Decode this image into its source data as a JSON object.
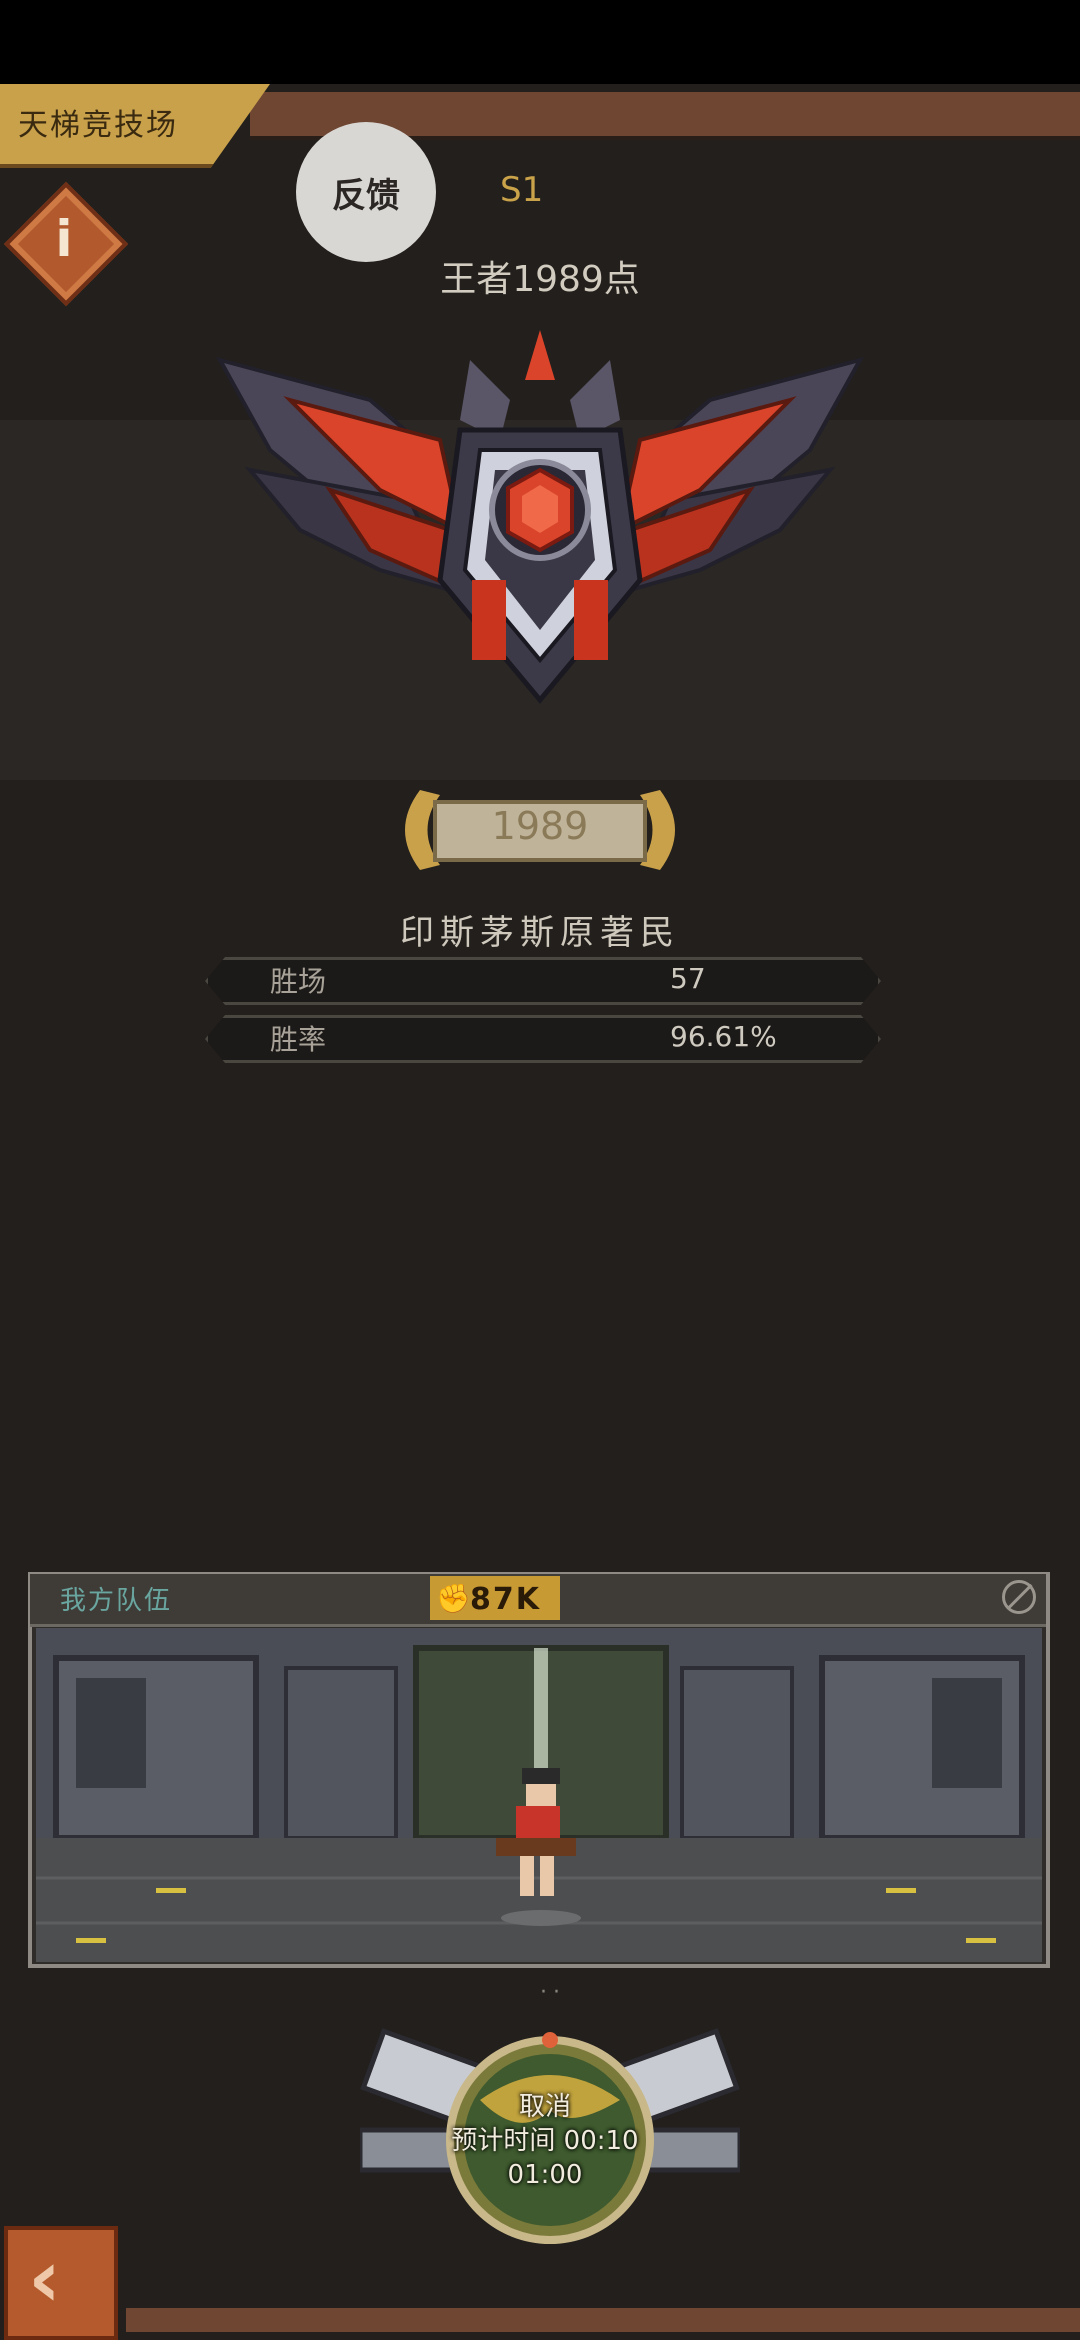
{
  "header": {
    "tab_label": "天梯竞技场",
    "feedback_label": "反馈",
    "season": "S1"
  },
  "rank": {
    "title": "王者1989点",
    "score": "1989"
  },
  "player": {
    "name": "印斯茅斯原著民"
  },
  "stats": [
    {
      "label": "胜场",
      "value": "57"
    },
    {
      "label": "胜率",
      "value": "96.61%"
    }
  ],
  "team": {
    "title": "我方队伍",
    "power": "87K"
  },
  "match": {
    "cancel_label": "取消",
    "estimate_label": "预计时间",
    "estimate_value": "00:10",
    "elapsed": "01:00"
  },
  "colors": {
    "accent_gold": "#c9a14a",
    "accent_orange": "#b25a2e",
    "bg": "#221f1c"
  },
  "icons": {
    "info": "info-icon",
    "back": "back-arrow-icon",
    "power": "fist-icon",
    "close": "close-circle-icon"
  }
}
